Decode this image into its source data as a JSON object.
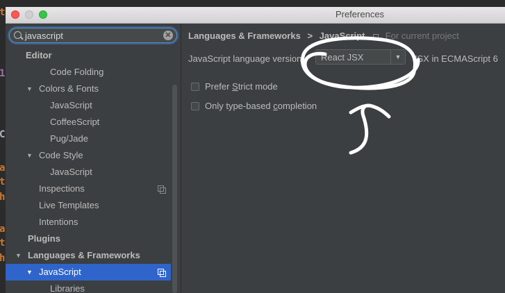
{
  "window": {
    "title": "Preferences"
  },
  "editor_gutter": {
    "chars": [
      "t",
      "1",
      "C",
      "a",
      "t",
      "h",
      "a",
      "t",
      "h"
    ]
  },
  "search": {
    "value": "javascript",
    "clear_glyph": "✕"
  },
  "tree": [
    {
      "label": "Editor",
      "bold": true,
      "arrow": ""
    },
    {
      "label": "Code Folding",
      "bold": false,
      "arrow": ""
    },
    {
      "label": "Colors & Fonts",
      "bold": false,
      "arrow": "▼"
    },
    {
      "label": "JavaScript",
      "bold": false,
      "arrow": ""
    },
    {
      "label": "CoffeeScript",
      "bold": false,
      "arrow": ""
    },
    {
      "label": "Pug/Jade",
      "bold": false,
      "arrow": ""
    },
    {
      "label": "Code Style",
      "bold": false,
      "arrow": "▼"
    },
    {
      "label": "JavaScript",
      "bold": false,
      "arrow": ""
    },
    {
      "label": "Inspections",
      "bold": false,
      "arrow": "",
      "project_icon": true
    },
    {
      "label": "Live Templates",
      "bold": false,
      "arrow": ""
    },
    {
      "label": "Intentions",
      "bold": false,
      "arrow": ""
    },
    {
      "label": "Plugins",
      "bold": true,
      "arrow": ""
    },
    {
      "label": "Languages & Frameworks",
      "bold": true,
      "arrow": "▼"
    },
    {
      "label": "JavaScript",
      "bold": false,
      "arrow": "▼",
      "selected": true,
      "project_icon": true
    },
    {
      "label": "Libraries",
      "bold": false,
      "arrow": ""
    }
  ],
  "content": {
    "breadcrumb": {
      "parent": "Languages & Frameworks",
      "separator": ">",
      "current": "JavaScript",
      "note": "For current project"
    },
    "language_version": {
      "label": "JavaScript language version",
      "value": "React JSX",
      "description": "JSX in ECMAScript 6"
    },
    "options": [
      {
        "label_before": "Prefer ",
        "mnemonic": "S",
        "label_after": "trict mode",
        "checked": false
      },
      {
        "label_before": "Only type-based ",
        "mnemonic": "c",
        "label_after": "ompletion",
        "checked": false
      }
    ]
  },
  "colors": {
    "selection": "#2f65ca",
    "annotation": "#ffffff",
    "gutter_orange": "#cc7832",
    "gutter_purple": "#9876aa"
  }
}
